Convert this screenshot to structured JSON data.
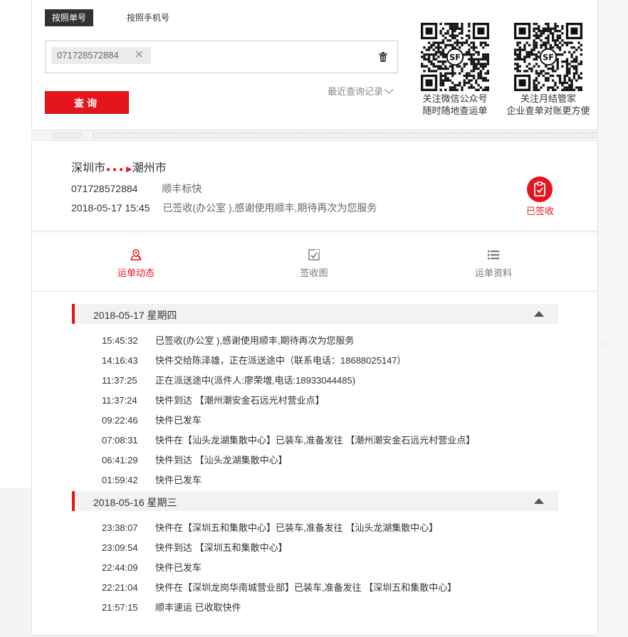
{
  "search": {
    "tab_waybill": "按照单号",
    "tab_phone": "按照手机号",
    "chip_value": "071728572884",
    "query_label": "查询",
    "recent_label": "最近查询记录"
  },
  "qr_wechat": {
    "line1": "关注微信公众号",
    "line2": "随时随地查运单"
  },
  "qr_monthly": {
    "line1": "关注月结管家",
    "line2": "企业查单对账更方便"
  },
  "result": {
    "from_city": "深圳市",
    "to_city": "潮州市",
    "waybill_no": "071728572884",
    "service": "顺丰标快",
    "latest_time": "2018-05-17 15:45",
    "latest_status": "已签收(办公室 ),感谢使用顺丰,期待再次为您服务",
    "status_badge": "已签收"
  },
  "tabs": {
    "tracking": "运单动态",
    "signature": "签收图",
    "details": "运单资料"
  },
  "days": [
    {
      "date": "2018-05-17 星期四",
      "events": [
        {
          "time": "15:45:32",
          "text": "已签收(办公室 ),感谢使用顺丰,期待再次为您服务"
        },
        {
          "time": "14:16:43",
          "text": "快件交给陈泽雄，正在派送途中（联系电话：18688025147）"
        },
        {
          "time": "11:37:25",
          "text": "正在派送途中(派件人:廖荣増,电话:18933044485)"
        },
        {
          "time": "11:37:24",
          "text": "快件到达 【潮州潮安金石远光村营业点】"
        },
        {
          "time": "09:22:46",
          "text": "快件已发车"
        },
        {
          "time": "07:08:31",
          "text": "快件在【汕头龙湖集散中心】已装车,准备发往 【潮州潮安金石远光村营业点】"
        },
        {
          "time": "06:41:29",
          "text": "快件到达 【汕头龙湖集散中心】"
        },
        {
          "time": "01:59:42",
          "text": "快件已发车"
        }
      ]
    },
    {
      "date": "2018-05-16 星期三",
      "events": [
        {
          "time": "23:38:07",
          "text": "快件在【深圳五和集散中心】已装车,准备发往 【汕头龙湖集散中心】"
        },
        {
          "time": "23:09:54",
          "text": "快件到达 【深圳五和集散中心】"
        },
        {
          "time": "22:44:09",
          "text": "快件已发车"
        },
        {
          "time": "22:21:04",
          "text": "快件在【深圳龙岗华南城营业部】已装车,准备发往 【深圳五和集散中心】"
        },
        {
          "time": "21:57:15",
          "text": "顺丰速运 已收取快件"
        }
      ]
    }
  ],
  "colors": {
    "accent": "#e5151d",
    "dark": "#333333"
  }
}
